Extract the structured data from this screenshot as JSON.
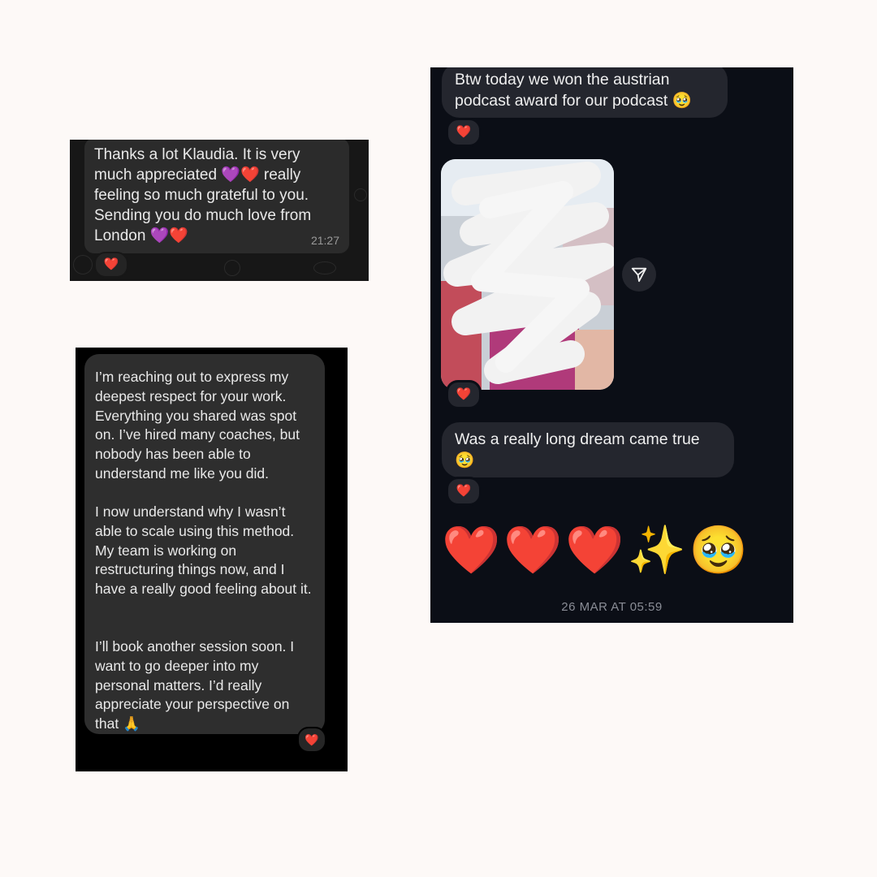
{
  "screenshot_1": {
    "message": "Thanks a lot Klaudia. It is very much appreciated 💜❤️ really feeling so much grateful to you. Sending you do much love from London 💜❤️",
    "time": "21:27",
    "reaction": "❤️"
  },
  "screenshot_2": {
    "paragraphs": [
      "I’m reaching out to express my deepest respect for your work. Everything you shared was spot on. I’ve hired many coaches, but nobody has been able to understand me like you did.",
      "I now understand why I wasn’t able to scale using this method. My team is working on restructuring things now, and I have a really good feeling about it.",
      "I’ll book another session soon. I want to go deeper into my personal matters. I’d really appreciate your perspective on that 🙏"
    ],
    "reaction": "❤️"
  },
  "screenshot_3": {
    "message_1": "Btw today we won the austrian podcast award for our podcast 🥹",
    "message_2": "Was a really long dream came true 🥹",
    "big_emoji": "❤️❤️❤️✨🥹",
    "timestamp": "26 MAR AT 05:59",
    "reaction": "❤️",
    "share_icon": "send-icon"
  }
}
